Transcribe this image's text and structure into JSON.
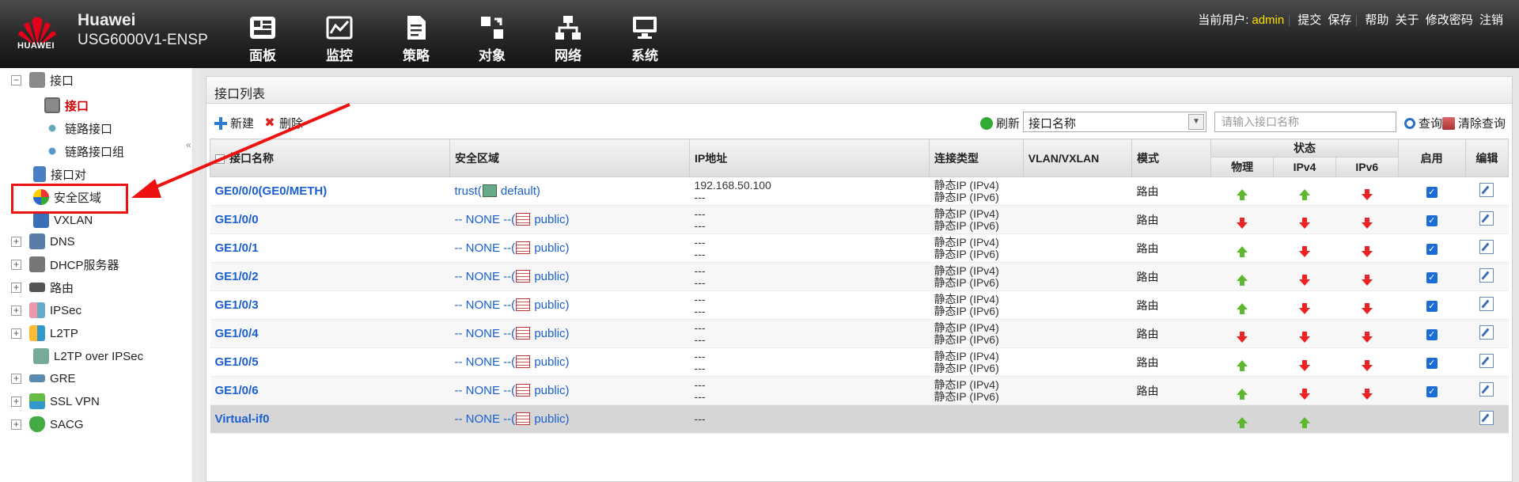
{
  "app": {
    "brand": "Huawei",
    "model": "USG6000V1-ENSP",
    "logo_text": "HUAWEI"
  },
  "nav": [
    {
      "label": "面板",
      "icon": "dashboard-icon"
    },
    {
      "label": "监控",
      "icon": "monitor-icon"
    },
    {
      "label": "策略",
      "icon": "policy-icon"
    },
    {
      "label": "对象",
      "icon": "object-icon"
    },
    {
      "label": "网络",
      "icon": "network-icon"
    },
    {
      "label": "系统",
      "icon": "system-icon"
    }
  ],
  "userbar": {
    "current_user_label": "当前用户:",
    "username": "admin",
    "links": [
      "提交",
      "保存",
      "帮助",
      "关于",
      "修改密码",
      "注销"
    ]
  },
  "sidebar": {
    "items": [
      {
        "label": "接口",
        "expand": "−"
      },
      {
        "label": "接口"
      },
      {
        "label": "链路接口"
      },
      {
        "label": "链路接口组"
      },
      {
        "label": "接口对"
      },
      {
        "label": "安全区域"
      },
      {
        "label": "VXLAN"
      },
      {
        "label": "DNS",
        "expand": "+"
      },
      {
        "label": "DHCP服务器",
        "expand": "+"
      },
      {
        "label": "路由",
        "expand": "+"
      },
      {
        "label": "IPSec",
        "expand": "+"
      },
      {
        "label": "L2TP",
        "expand": "+"
      },
      {
        "label": "L2TP over IPSec"
      },
      {
        "label": "GRE",
        "expand": "+"
      },
      {
        "label": "SSL VPN",
        "expand": "+"
      },
      {
        "label": "SACG",
        "expand": "+"
      }
    ]
  },
  "panel": {
    "title": "接口列表",
    "toolbar": {
      "new_label": "新建",
      "delete_label": "删除",
      "refresh_label": "刷新",
      "filter_value": "接口名称",
      "search_placeholder": "请输入接口名称",
      "query_label": "查询",
      "clear_label": "清除查询"
    },
    "columns": {
      "name": "接口名称",
      "zone": "安全区域",
      "ip": "IP地址",
      "conn_type": "连接类型",
      "vlan": "VLAN/VXLAN",
      "mode": "模式",
      "status": "状态",
      "physical": "物理",
      "ipv4": "IPv4",
      "ipv6": "IPv6",
      "enable": "启用",
      "edit": "编辑"
    },
    "rows": [
      {
        "name": "GE0/0/0(GE0/METH)",
        "zone_pre": "trust(",
        "zone_post": " default)",
        "ip1": "192.168.50.100",
        "ip2": "---",
        "ct1": "静态IP (IPv4)",
        "ct2": "静态IP (IPv6)",
        "mode": "路由",
        "phys": "up",
        "v4": "up",
        "v6": "down",
        "enabled": true
      },
      {
        "name": "GE1/0/0",
        "zone_pre": "-- NONE --(",
        "zone_post": " public)",
        "ip1": "---",
        "ip2": "---",
        "ct1": "静态IP (IPv4)",
        "ct2": "静态IP (IPv6)",
        "mode": "路由",
        "phys": "down",
        "v4": "down",
        "v6": "down",
        "enabled": true
      },
      {
        "name": "GE1/0/1",
        "zone_pre": "-- NONE --(",
        "zone_post": " public)",
        "ip1": "---",
        "ip2": "---",
        "ct1": "静态IP (IPv4)",
        "ct2": "静态IP (IPv6)",
        "mode": "路由",
        "phys": "up",
        "v4": "down",
        "v6": "down",
        "enabled": true
      },
      {
        "name": "GE1/0/2",
        "zone_pre": "-- NONE --(",
        "zone_post": " public)",
        "ip1": "---",
        "ip2": "---",
        "ct1": "静态IP (IPv4)",
        "ct2": "静态IP (IPv6)",
        "mode": "路由",
        "phys": "up",
        "v4": "down",
        "v6": "down",
        "enabled": true
      },
      {
        "name": "GE1/0/3",
        "zone_pre": "-- NONE --(",
        "zone_post": " public)",
        "ip1": "---",
        "ip2": "---",
        "ct1": "静态IP (IPv4)",
        "ct2": "静态IP (IPv6)",
        "mode": "路由",
        "phys": "up",
        "v4": "down",
        "v6": "down",
        "enabled": true
      },
      {
        "name": "GE1/0/4",
        "zone_pre": "-- NONE --(",
        "zone_post": " public)",
        "ip1": "---",
        "ip2": "---",
        "ct1": "静态IP (IPv4)",
        "ct2": "静态IP (IPv6)",
        "mode": "路由",
        "phys": "down",
        "v4": "down",
        "v6": "down",
        "enabled": true
      },
      {
        "name": "GE1/0/5",
        "zone_pre": "-- NONE --(",
        "zone_post": " public)",
        "ip1": "---",
        "ip2": "---",
        "ct1": "静态IP (IPv4)",
        "ct2": "静态IP (IPv6)",
        "mode": "路由",
        "phys": "up",
        "v4": "down",
        "v6": "down",
        "enabled": true
      },
      {
        "name": "GE1/0/6",
        "zone_pre": "-- NONE --(",
        "zone_post": " public)",
        "ip1": "---",
        "ip2": "---",
        "ct1": "静态IP (IPv4)",
        "ct2": "静态IP (IPv6)",
        "mode": "路由",
        "phys": "up",
        "v4": "down",
        "v6": "down",
        "enabled": true
      },
      {
        "name": "Virtual-if0",
        "zone_pre": "-- NONE --(",
        "zone_post": " public)",
        "ip1": "---",
        "ip2": "",
        "ct1": "",
        "ct2": "",
        "mode": "",
        "phys": "up",
        "v4": "up",
        "v6": "",
        "enabled": null
      }
    ]
  },
  "colors": {
    "accent_link": "#1a5fd0",
    "status_up": "#5cb82e",
    "status_down": "#e22222",
    "annotation_red": "#e11111",
    "username": "#ffe000"
  }
}
